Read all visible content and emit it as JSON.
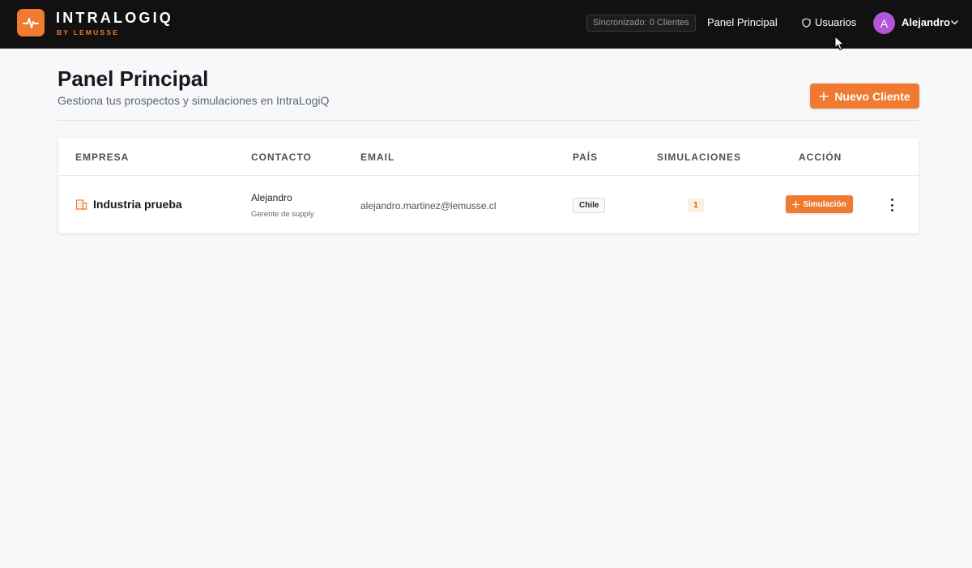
{
  "brand": {
    "name": "INTRALOGIQ",
    "sub": "BY LEMUSSE",
    "color": "#ef7a30"
  },
  "nav": {
    "sync_status": "Sincronizado: 0 Clientes",
    "panel_link": "Panel Principal",
    "users_link": "Usuarios",
    "avatar_initial": "A",
    "user_name": "Alejandro"
  },
  "page": {
    "title": "Panel Principal",
    "subtitle": "Gestiona tus prospectos y simulaciones en IntraLogiQ",
    "new_client_label": "Nuevo Cliente"
  },
  "table": {
    "headers": {
      "company": "EMPRESA",
      "contact": "CONTACTO",
      "email": "EMAIL",
      "country": "PAÍS",
      "simulations": "SIMULACIONES",
      "action": "ACCIÓN"
    },
    "rows": [
      {
        "company": "Industria prueba",
        "contact_name": "Alejandro",
        "contact_role": "Gerente de supply",
        "email": "alejandro.martinez@lemusse.cl",
        "country": "Chile",
        "simulations": "1",
        "action_label": "Simulación"
      }
    ]
  },
  "icons": {
    "logo": "pulse-icon",
    "users": "shield-icon",
    "user_menu": "chevron-down-icon",
    "add": "plus-icon",
    "company": "building-icon",
    "more": "kebab-menu-icon"
  }
}
